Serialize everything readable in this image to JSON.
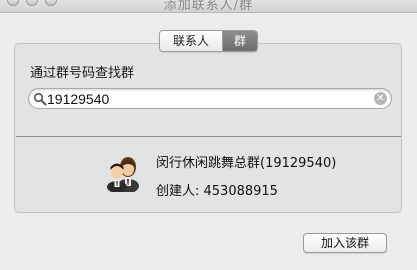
{
  "window": {
    "title": "添加联系人/群"
  },
  "tabs": [
    {
      "label": "联系人",
      "selected": false
    },
    {
      "label": "群",
      "selected": true
    }
  ],
  "search": {
    "label": "通过群号码查找群",
    "value": "19129540",
    "search_icon": "magnifier-icon",
    "clear_icon": "clear-icon"
  },
  "result": {
    "name": "闵行休闲跳舞总群(19129540)",
    "creator": "创建人: 453088915",
    "avatar_icon": "group-avatar-icon"
  },
  "actions": {
    "join_label": "加入该群"
  },
  "colors": {
    "selected_tab": "#7b7b7b",
    "window_bg": "#ececec",
    "panel_bg": "#e3e3e3"
  }
}
